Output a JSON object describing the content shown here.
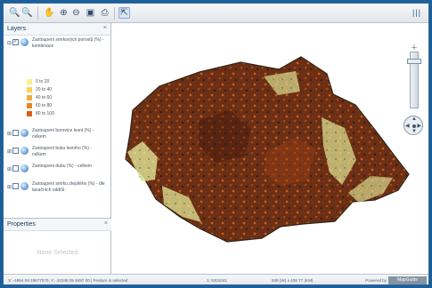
{
  "toolbar": {
    "tools": [
      {
        "name": "zoom-in-tool-icon",
        "glyph": "🔍"
      },
      {
        "name": "zoom-out-tool-icon",
        "glyph": "🔍"
      },
      {
        "name": "pan-tool-icon",
        "glyph": "✋"
      },
      {
        "name": "zoom-previous-icon",
        "glyph": "⊕"
      },
      {
        "name": "zoom-next-icon",
        "glyph": "⊖"
      },
      {
        "name": "measure-icon",
        "glyph": "▣"
      },
      {
        "name": "print-icon",
        "glyph": "⎙"
      },
      {
        "name": "select-feature-icon",
        "glyph": "⇱"
      }
    ],
    "right_icon_text": "|||"
  },
  "sidebar": {
    "layers_title": "Layers",
    "layers": [
      {
        "label": "Zastoupení smrkových porostů (%) - kombinace",
        "checked": true
      },
      {
        "label": "Zastoupení borovice lesní (%) - celkem",
        "checked": false
      },
      {
        "label": "Zastoupení buku lesního (%) - celkem",
        "checked": false
      },
      {
        "label": "Zastoupení dubu (%) - celkem",
        "checked": false
      },
      {
        "label": "Zastoupení smrku ztepilého (%) - dle taxačních oddílů",
        "checked": false
      }
    ],
    "legend": [
      {
        "label": "0 to 20",
        "color": "#ffef8a"
      },
      {
        "label": "20 to 40",
        "color": "#ffd257"
      },
      {
        "label": "40 to 60",
        "color": "#f5ac37"
      },
      {
        "label": "60 to 80",
        "color": "#eb8320"
      },
      {
        "label": "80 to 100",
        "color": "#d66015"
      }
    ],
    "properties_title": "Properties",
    "none_selected": "None Selected"
  },
  "statusbar": {
    "coords": "X: -4954 09 29677070, Y: -10348 05 8497 00 | Feature is selected",
    "scale": "1: 5201041",
    "extent": "538 (W) x 428 77 (KM)",
    "powered_by": "Powered by",
    "brand": "MapGuide"
  },
  "map": {
    "zoom_level": 0.86
  }
}
